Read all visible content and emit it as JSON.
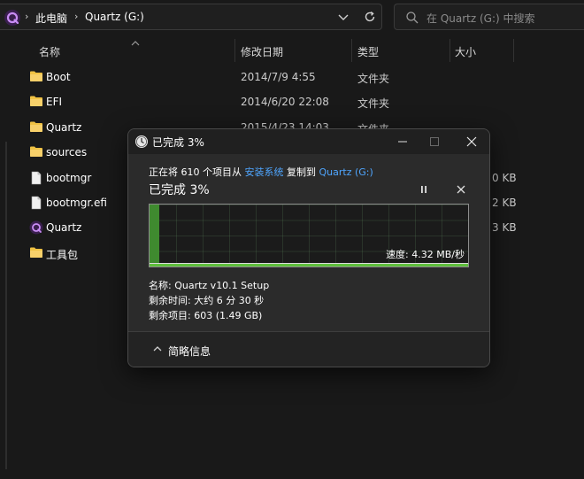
{
  "address_bar": {
    "crumbs": [
      "此电脑",
      "Quartz (G:)"
    ]
  },
  "search": {
    "placeholder": "在 Quartz (G:) 中搜索"
  },
  "columns": {
    "name": "名称",
    "modified": "修改日期",
    "type": "类型",
    "size": "大小"
  },
  "files": [
    {
      "name": "Boot",
      "date": "2014/7/9 4:55",
      "type": "文件夹",
      "size": "",
      "icon": "folder-icon"
    },
    {
      "name": "EFI",
      "date": "2014/6/20 22:08",
      "type": "文件夹",
      "size": "",
      "icon": "folder-icon"
    },
    {
      "name": "Quartz",
      "date": "2015/4/23 14:03",
      "type": "文件夹",
      "size": "",
      "icon": "folder-icon"
    },
    {
      "name": "sources",
      "date": "",
      "type": "",
      "size": "",
      "icon": "folder-icon"
    },
    {
      "name": "bootmgr",
      "date": "",
      "type": "",
      "size": "0 KB",
      "icon": "file-icon"
    },
    {
      "name": "bootmgr.efi",
      "date": "",
      "type": "",
      "size": "2 KB",
      "icon": "file-icon"
    },
    {
      "name": "Quartz",
      "date": "",
      "type": "",
      "size": "3 KB",
      "icon": "quartz-app-icon"
    },
    {
      "name": "工具包",
      "date": "",
      "type": "",
      "size": "",
      "icon": "folder-icon"
    }
  ],
  "dialog": {
    "title": "已完成 3%",
    "info_prefix": "正在将 610 个项目从",
    "source": "安装系统",
    "info_mid": "复制到",
    "destination": "Quartz (G:)",
    "percent_label": "已完成 3%",
    "progress": 0.03,
    "speed": "速度: 4.32 MB/秒",
    "name_line": "名称: Quartz v10.1 Setup",
    "time_line": "剩余时间: 大约 6 分 30 秒",
    "items_line": "剩余项目: 603 (1.49 GB)",
    "details_toggle": "简略信息"
  },
  "colors": {
    "background": "#191919",
    "dialog_bg": "#2b2b2b",
    "link": "#4fa6ff",
    "progress_fill": "#3f8a2f",
    "folder": "#f0c244",
    "quartz_brand": "#b565e8"
  }
}
